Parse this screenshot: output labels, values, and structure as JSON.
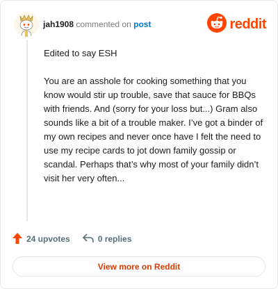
{
  "header": {
    "username": "jah1908",
    "action_text": "commented on",
    "post_link": "post",
    "brand": "reddit",
    "avatar_icon": "snoo-avatar-icon",
    "brand_icon": "reddit-logo-icon"
  },
  "comment": {
    "paragraphs": [
      "Edited to say ESH",
      "You are an asshole for cooking something that you know would stir up trouble, save that sauce for BBQs with friends. And (sorry for your loss but...) Gram also sounds like a bit of a trouble maker. I’ve got a binder of my own recipes and never once have I felt the need to use my recipe cards to jot down family gossip or scandal. Perhaps that’s why most of your family didn’t visit her very often..."
    ]
  },
  "stats": {
    "upvotes": "24 upvotes",
    "replies": "0 replies"
  },
  "footer": {
    "view_more": "View more on Reddit"
  },
  "colors": {
    "brand": "#ff4500",
    "link": "#0079d3",
    "view_more": "#d93a00"
  }
}
